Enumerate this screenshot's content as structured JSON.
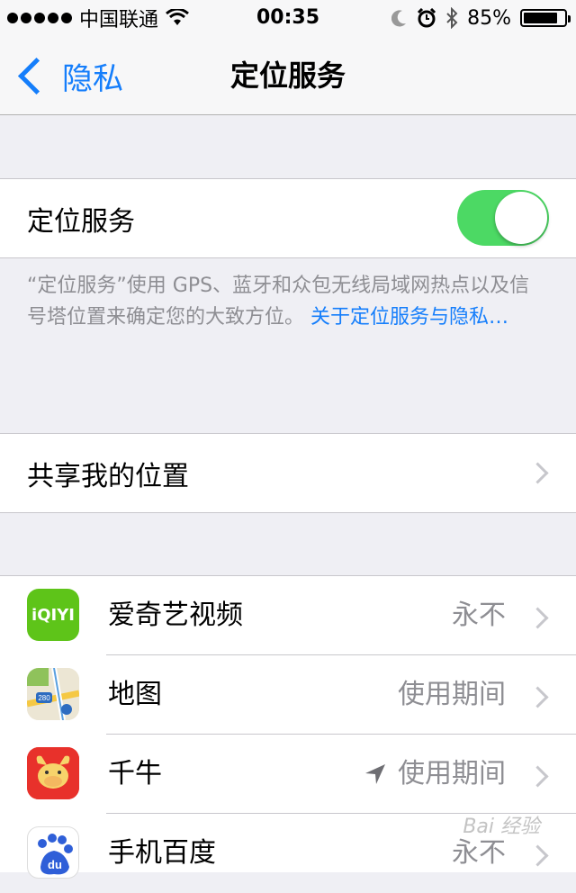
{
  "status_bar": {
    "carrier": "中国联通",
    "time": "00:35",
    "battery": "85%",
    "battery_level": 0.85
  },
  "nav": {
    "back_label": "隐私",
    "title": "定位服务"
  },
  "location_toggle": {
    "label": "定位服务",
    "on": true
  },
  "footer": {
    "text": "“定位服务”使用 GPS、蓝牙和众包无线局域网热点以及信号塔位置来确定您的大致方位。",
    "link": "关于定位服务与隐私…"
  },
  "share_location": {
    "label": "共享我的位置"
  },
  "apps": [
    {
      "name": "爱奇艺视频",
      "value": "永不",
      "icon": "iqiyi-icon",
      "icon_text": "iQIYI"
    },
    {
      "name": "地图",
      "value": "使用期间",
      "icon": "maps-icon",
      "icon_text": "280"
    },
    {
      "name": "千牛",
      "value": "使用期间",
      "icon": "qianniu-icon",
      "recent_location": true
    },
    {
      "name": "手机百度",
      "value": "永不",
      "icon": "baidu-icon",
      "icon_text": "du"
    }
  ],
  "colors": {
    "accent": "#157efb",
    "toggle_on": "#4cd964",
    "secondary_text": "#8e8e93",
    "background": "#efeff4"
  },
  "watermark": "Bai 经验"
}
